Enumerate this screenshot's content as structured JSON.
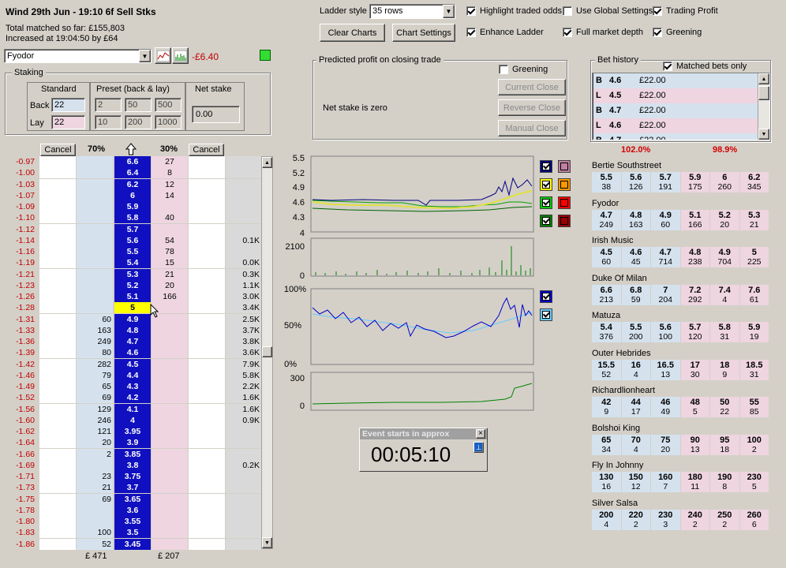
{
  "header": {
    "market_title": "Wind 29th Jun - 19:10 6f Sell Stks",
    "total_matched": "Total matched so far: £155,803",
    "increased": "Increased at 19:04:50 by £64",
    "selected_runner": "Fyodor",
    "runner_pl": "-£6.40"
  },
  "toolbar": {
    "ladder_style_label": "Ladder style",
    "ladder_style_value": "35 rows",
    "clear_charts": "Clear Charts",
    "chart_settings": "Chart Settings",
    "options": [
      {
        "label": "Highlight traded odds",
        "checked": true
      },
      {
        "label": "Use Global Settings",
        "checked": false
      },
      {
        "label": "Trading Profit",
        "checked": true
      },
      {
        "label": "Enhance Ladder",
        "checked": true
      },
      {
        "label": "Full market depth",
        "checked": true
      },
      {
        "label": "Greening",
        "checked": true
      }
    ]
  },
  "staking": {
    "title": "Staking",
    "standard_label": "Standard",
    "preset_label": "Preset (back & lay)",
    "net_stake_label": "Net stake",
    "back_label": "Back",
    "lay_label": "Lay",
    "back_value": "22",
    "lay_value": "22",
    "preset_back": [
      "2",
      "50",
      "500"
    ],
    "preset_lay": [
      "10",
      "200",
      "1000"
    ],
    "net_stake_value": "0.00"
  },
  "predicted": {
    "title": "Predicted profit on closing trade",
    "greening_label": "Greening",
    "net_text": "Net stake is zero",
    "current_close": "Current Close",
    "reverse_close": "Reverse Close",
    "manual_close": "Manual Close"
  },
  "ladder": {
    "cancel_left": "Cancel",
    "cancel_right": "Cancel",
    "back_pct": "70%",
    "lay_pct": "30%",
    "footer_back": "£ 471",
    "footer_lay": "£ 207",
    "rows": [
      {
        "pl": "-0.97",
        "back": "",
        "odds": "6.6",
        "lay": "27",
        "vol": ""
      },
      {
        "pl": "-1.00",
        "back": "",
        "odds": "6.4",
        "lay": "8",
        "vol": ""
      },
      {
        "pl": "-1.03",
        "back": "",
        "odds": "6.2",
        "lay": "12",
        "vol": ""
      },
      {
        "pl": "-1.07",
        "back": "",
        "odds": "6",
        "lay": "14",
        "vol": ""
      },
      {
        "pl": "-1.09",
        "back": "",
        "odds": "5.9",
        "lay": "",
        "vol": ""
      },
      {
        "pl": "-1.10",
        "back": "",
        "odds": "5.8",
        "lay": "40",
        "vol": ""
      },
      {
        "pl": "-1.12",
        "back": "",
        "odds": "5.7",
        "lay": "",
        "vol": ""
      },
      {
        "pl": "-1.14",
        "back": "",
        "odds": "5.6",
        "lay": "54",
        "vol": "0.1K"
      },
      {
        "pl": "-1.16",
        "back": "",
        "odds": "5.5",
        "lay": "78",
        "vol": ""
      },
      {
        "pl": "-1.19",
        "back": "",
        "odds": "5.4",
        "lay": "15",
        "vol": "0.0K"
      },
      {
        "pl": "-1.21",
        "back": "",
        "odds": "5.3",
        "lay": "21",
        "vol": "0.3K"
      },
      {
        "pl": "-1.23",
        "back": "",
        "odds": "5.2",
        "lay": "20",
        "vol": "1.1K"
      },
      {
        "pl": "-1.26",
        "back": "",
        "odds": "5.1",
        "lay": "166",
        "vol": "3.0K"
      },
      {
        "pl": "-1.28",
        "back": "",
        "odds": "5",
        "lay": "",
        "vol": "3.4K",
        "current": true
      },
      {
        "pl": "-1.31",
        "back": "60",
        "odds": "4.9",
        "lay": "",
        "vol": "2.5K"
      },
      {
        "pl": "-1.33",
        "back": "163",
        "odds": "4.8",
        "lay": "",
        "vol": "3.7K"
      },
      {
        "pl": "-1.36",
        "back": "249",
        "odds": "4.7",
        "lay": "",
        "vol": "3.8K"
      },
      {
        "pl": "-1.39",
        "back": "80",
        "odds": "4.6",
        "lay": "",
        "vol": "3.6K"
      },
      {
        "pl": "-1.42",
        "back": "282",
        "odds": "4.5",
        "lay": "",
        "vol": "7.9K"
      },
      {
        "pl": "-1.46",
        "back": "79",
        "odds": "4.4",
        "lay": "",
        "vol": "5.8K"
      },
      {
        "pl": "-1.49",
        "back": "65",
        "odds": "4.3",
        "lay": "",
        "vol": "2.2K"
      },
      {
        "pl": "-1.52",
        "back": "69",
        "odds": "4.2",
        "lay": "",
        "vol": "1.6K"
      },
      {
        "pl": "-1.56",
        "back": "129",
        "odds": "4.1",
        "lay": "",
        "vol": "1.6K"
      },
      {
        "pl": "-1.60",
        "back": "246",
        "odds": "4",
        "lay": "",
        "vol": "0.9K"
      },
      {
        "pl": "-1.62",
        "back": "121",
        "odds": "3.95",
        "lay": "",
        "vol": ""
      },
      {
        "pl": "-1.64",
        "back": "20",
        "odds": "3.9",
        "lay": "",
        "vol": ""
      },
      {
        "pl": "-1.66",
        "back": "2",
        "odds": "3.85",
        "lay": "",
        "vol": ""
      },
      {
        "pl": "-1.69",
        "back": "",
        "odds": "3.8",
        "lay": "",
        "vol": "0.2K"
      },
      {
        "pl": "-1.71",
        "back": "23",
        "odds": "3.75",
        "lay": "",
        "vol": ""
      },
      {
        "pl": "-1.73",
        "back": "21",
        "odds": "3.7",
        "lay": "",
        "vol": ""
      },
      {
        "pl": "-1.75",
        "back": "69",
        "odds": "3.65",
        "lay": "",
        "vol": ""
      },
      {
        "pl": "-1.78",
        "back": "",
        "odds": "3.6",
        "lay": "",
        "vol": ""
      },
      {
        "pl": "-1.80",
        "back": "",
        "odds": "3.55",
        "lay": "",
        "vol": ""
      },
      {
        "pl": "-1.83",
        "back": "100",
        "odds": "3.5",
        "lay": "",
        "vol": ""
      },
      {
        "pl": "-1.86",
        "back": "52",
        "odds": "3.45",
        "lay": "",
        "vol": ""
      }
    ]
  },
  "charts": {
    "price_ticks": [
      "5.5",
      "5.2",
      "4.9",
      "4.6",
      "4.3",
      "4"
    ],
    "volume_ticks": [
      "2100",
      "0"
    ],
    "pct_ticks": [
      "100%",
      "50%",
      "0%"
    ],
    "bottom_ticks": [
      "300",
      "0"
    ],
    "price_swatches": [
      {
        "color": "#000080",
        "checked": true
      },
      {
        "color": "#c080a0",
        "checked": false
      },
      {
        "color": "#ffff00",
        "checked": true
      },
      {
        "color": "#ff9900",
        "checked": false
      },
      {
        "color": "#00cc00",
        "checked": true
      },
      {
        "color": "#ff0000",
        "checked": false
      },
      {
        "color": "#008000",
        "checked": true
      },
      {
        "color": "#990000",
        "checked": false
      }
    ],
    "pct_swatches": [
      {
        "color": "#0000cc",
        "checked": true
      },
      {
        "color": "#66ccff",
        "checked": true
      }
    ]
  },
  "event_timer": {
    "title": "Event starts in approx",
    "time": "00:05:10"
  },
  "bet_history": {
    "title": "Bet history",
    "matched_only_label": "Matched bets only",
    "bets": [
      {
        "type": "B",
        "odds": "4.6",
        "stake": "£22.00"
      },
      {
        "type": "L",
        "odds": "4.5",
        "stake": "£22.00"
      },
      {
        "type": "B",
        "odds": "4.7",
        "stake": "£22.00"
      },
      {
        "type": "L",
        "odds": "4.6",
        "stake": "£22.00"
      },
      {
        "type": "B",
        "odds": "4.7",
        "stake": "£22.00"
      }
    ],
    "back_book": "102.0%",
    "lay_book": "98.9%"
  },
  "runners": [
    {
      "name": "Bertie Southstreet",
      "cells": [
        [
          "5.5",
          "38"
        ],
        [
          "5.6",
          "126"
        ],
        [
          "5.7",
          "191"
        ],
        [
          "5.9",
          "175"
        ],
        [
          "6",
          "260"
        ],
        [
          "6.2",
          "345"
        ]
      ]
    },
    {
      "name": "Fyodor",
      "cells": [
        [
          "4.7",
          "249"
        ],
        [
          "4.8",
          "163"
        ],
        [
          "4.9",
          "60"
        ],
        [
          "5.1",
          "166"
        ],
        [
          "5.2",
          "20"
        ],
        [
          "5.3",
          "21"
        ]
      ]
    },
    {
      "name": "Irish Music",
      "cells": [
        [
          "4.5",
          "60"
        ],
        [
          "4.6",
          "45"
        ],
        [
          "4.7",
          "714"
        ],
        [
          "4.8",
          "238"
        ],
        [
          "4.9",
          "704"
        ],
        [
          "5",
          "225"
        ]
      ]
    },
    {
      "name": "Duke Of Milan",
      "cells": [
        [
          "6.6",
          "213"
        ],
        [
          "6.8",
          "59"
        ],
        [
          "7",
          "204"
        ],
        [
          "7.2",
          "292"
        ],
        [
          "7.4",
          "4"
        ],
        [
          "7.6",
          "61"
        ]
      ]
    },
    {
      "name": "Matuza",
      "cells": [
        [
          "5.4",
          "376"
        ],
        [
          "5.5",
          "200"
        ],
        [
          "5.6",
          "100"
        ],
        [
          "5.7",
          "120"
        ],
        [
          "5.8",
          "31"
        ],
        [
          "5.9",
          "19"
        ]
      ]
    },
    {
      "name": "Outer Hebrides",
      "cells": [
        [
          "15.5",
          "52"
        ],
        [
          "16",
          "4"
        ],
        [
          "16.5",
          "13"
        ],
        [
          "17",
          "30"
        ],
        [
          "18",
          "9"
        ],
        [
          "18.5",
          "31"
        ]
      ]
    },
    {
      "name": "Richardlionheart",
      "cells": [
        [
          "42",
          "9"
        ],
        [
          "44",
          "17"
        ],
        [
          "46",
          "49"
        ],
        [
          "48",
          "5"
        ],
        [
          "50",
          "22"
        ],
        [
          "55",
          "85"
        ]
      ]
    },
    {
      "name": "Bolshoi King",
      "cells": [
        [
          "65",
          "34"
        ],
        [
          "70",
          "4"
        ],
        [
          "75",
          "20"
        ],
        [
          "90",
          "13"
        ],
        [
          "95",
          "18"
        ],
        [
          "100",
          "2"
        ]
      ]
    },
    {
      "name": "Fly In Johnny",
      "cells": [
        [
          "130",
          "16"
        ],
        [
          "150",
          "12"
        ],
        [
          "160",
          "7"
        ],
        [
          "180",
          "11"
        ],
        [
          "190",
          "8"
        ],
        [
          "230",
          "5"
        ]
      ]
    },
    {
      "name": "Silver Salsa",
      "cells": [
        [
          "200",
          "4"
        ],
        [
          "220",
          "2"
        ],
        [
          "230",
          "3"
        ],
        [
          "240",
          "2"
        ],
        [
          "250",
          "2"
        ],
        [
          "260",
          "6"
        ]
      ]
    }
  ]
}
